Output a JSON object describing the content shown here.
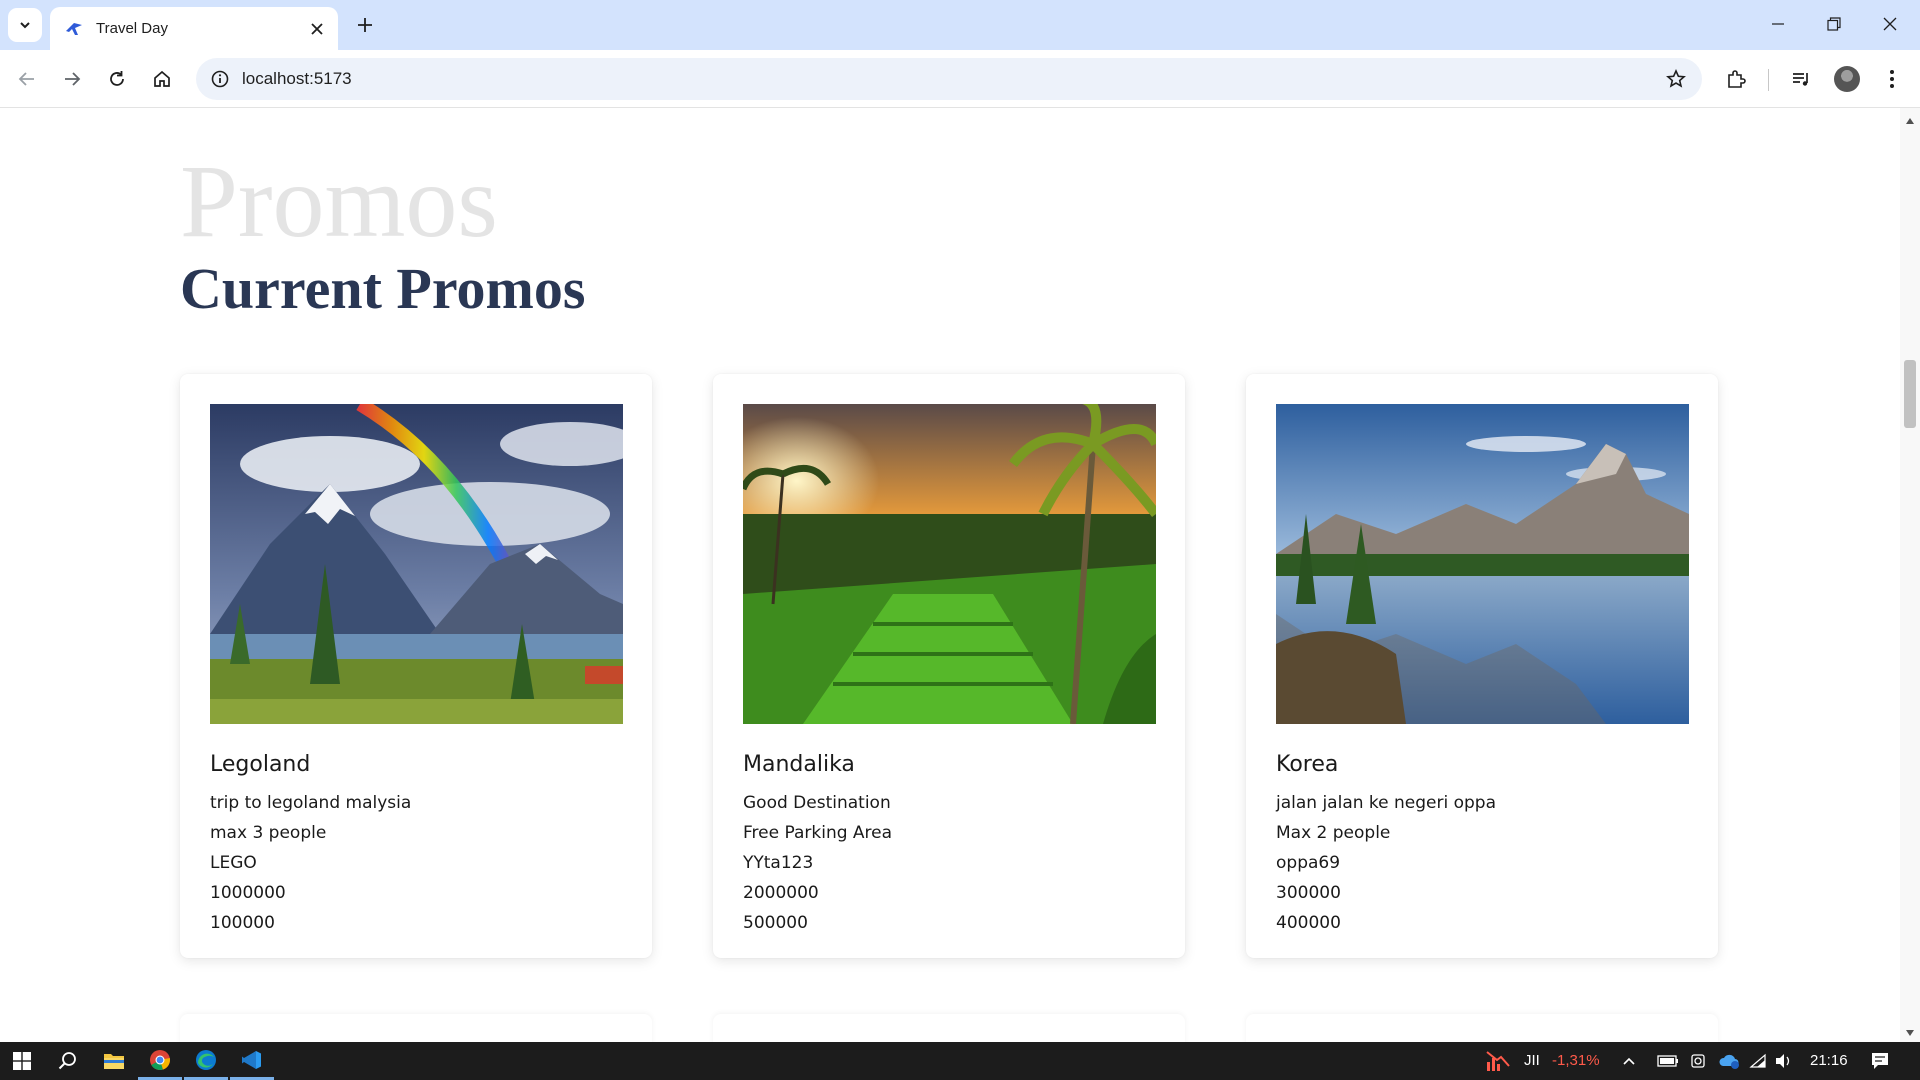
{
  "browser": {
    "tab_title": "Travel Day",
    "url": "localhost:5173",
    "icons": {
      "tab_search": "chevron-down-icon",
      "tab_close": "close-icon",
      "new_tab": "plus-icon",
      "minimize": "minimize-icon",
      "restore": "restore-icon",
      "close_window": "close-icon",
      "back": "arrow-left-icon",
      "forward": "arrow-right-icon",
      "reload": "reload-icon",
      "home": "home-icon",
      "site_info": "info-icon",
      "bookmark": "star-icon",
      "extensions": "puzzle-icon",
      "media": "media-control-icon",
      "profile": "avatar",
      "menu": "more-vertical-icon"
    }
  },
  "page": {
    "background_title": "Promos",
    "title": "Current Promos",
    "promos": [
      {
        "title": "Legoland",
        "lines": [
          "trip to legoland malysia",
          "max 3 people",
          "LEGO",
          "1000000",
          "100000"
        ],
        "image": "mountain-rainbow-landscape"
      },
      {
        "title": "Mandalika",
        "lines": [
          "Good Destination",
          "Free Parking Area",
          "YYta123",
          "2000000",
          "500000"
        ],
        "image": "rice-field-palm-sunset"
      },
      {
        "title": "Korea",
        "lines": [
          "jalan jalan ke negeri oppa",
          "Max 2 people",
          "oppa69",
          "300000",
          "400000"
        ],
        "image": "mountain-lake-reflection"
      }
    ]
  },
  "taskbar": {
    "stock_ticker": "JII",
    "stock_change": "-1,31%",
    "time": "21:16",
    "colors": {
      "stock_negative": "#ff5a4a",
      "accent": "#7ab0e8"
    }
  },
  "colors": {
    "title": "#2a3754",
    "background_title": "#e4e4e4",
    "tabbar": "#d3e3fd",
    "omnibox": "#edf2fa"
  }
}
